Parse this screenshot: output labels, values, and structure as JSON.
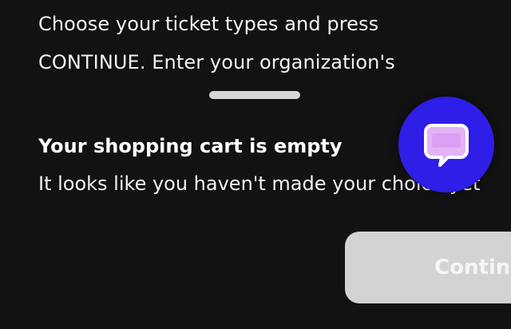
{
  "instructions": {
    "line1": "Choose your ticket types and press",
    "line2": "CONTINUE. Enter your organization's"
  },
  "cart": {
    "title": "Your shopping cart is empty",
    "subtitle": "It looks like you haven't made your choice yet"
  },
  "actions": {
    "continue_label": "Continue"
  },
  "chat": {
    "icon": "chat-bubble-icon"
  },
  "colors": {
    "background": "#121212",
    "chat_button": "#2f1de8",
    "chat_icon": "#e4b3f7",
    "continue_disabled": "#d3d3d3",
    "drag_handle": "#d6d6d6"
  }
}
